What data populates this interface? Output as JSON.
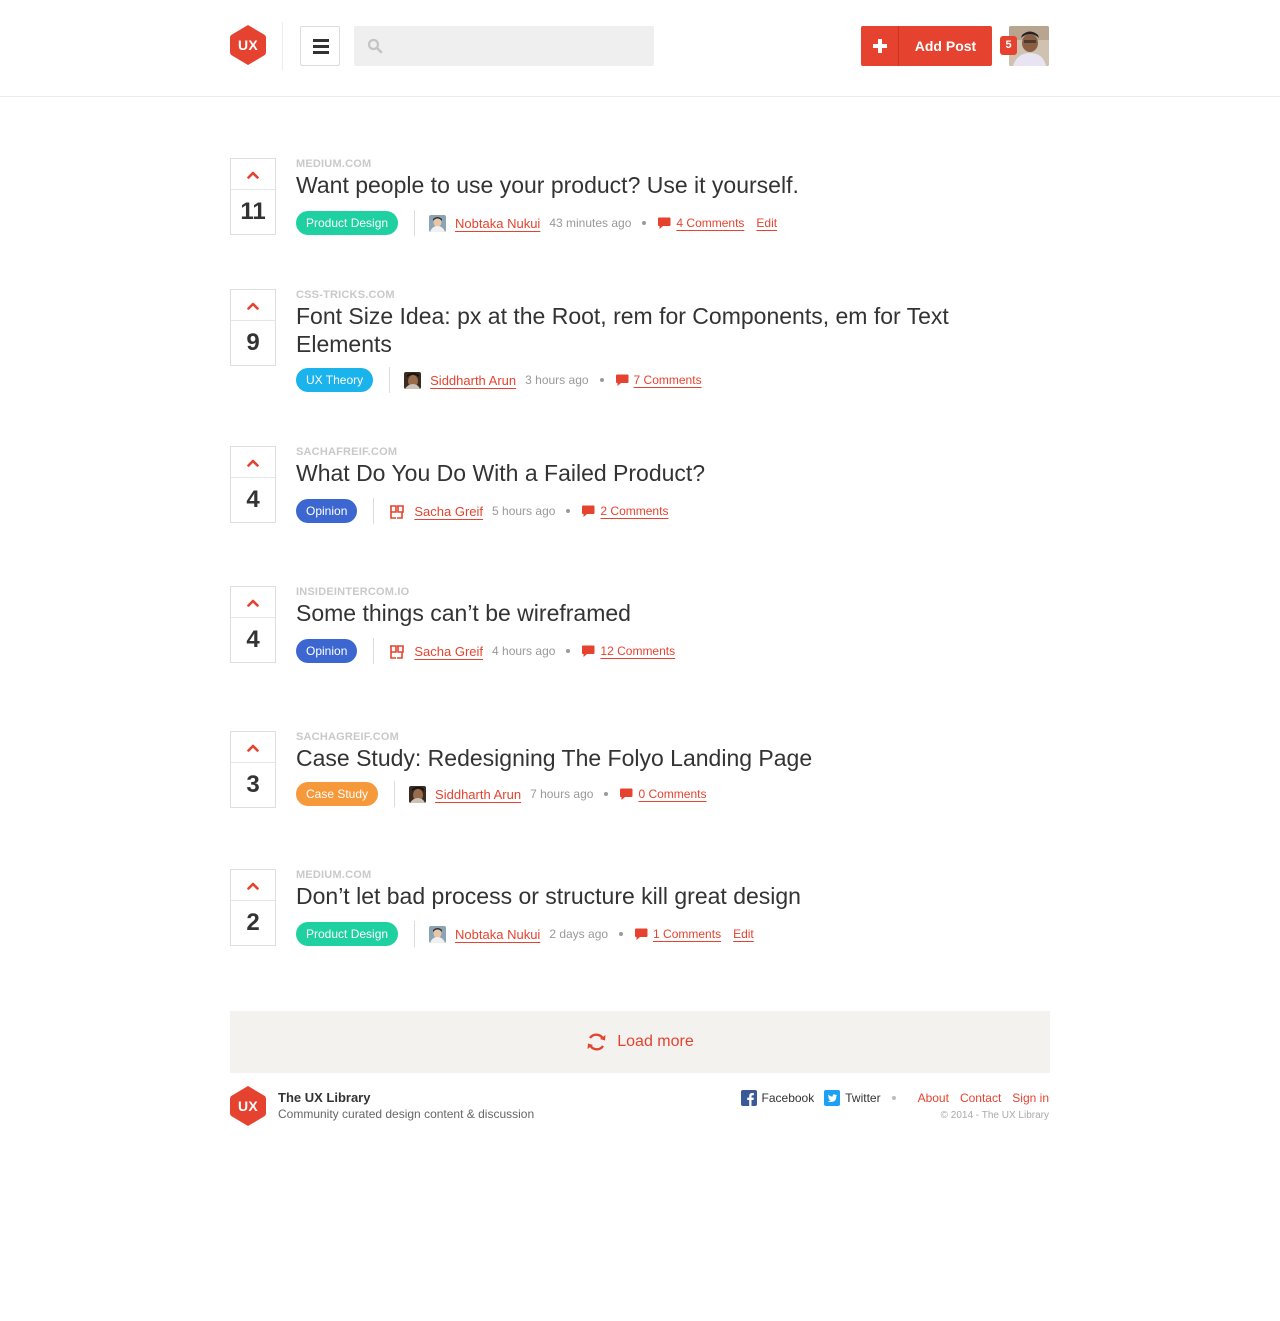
{
  "header": {
    "logo_text": "UX",
    "search": {
      "placeholder": "",
      "value": ""
    },
    "add_post_label": "Add Post",
    "notification_count": "5"
  },
  "posts": [
    {
      "votes": "11",
      "domain": "MEDIUM.COM",
      "title": "Want people to use your product? Use it yourself.",
      "tag": "Product Design",
      "tag_color": "#1fd1a0",
      "author": "Nobtaka Nukui",
      "time": "43 minutes ago",
      "comments": "4 Comments",
      "edit": "Edit"
    },
    {
      "votes": "9",
      "domain": "CSS-TRICKS.COM",
      "title": "Font Size Idea: px at the Root, rem for Components, em for Text Elements",
      "tag": "UX Theory",
      "tag_color": "#1ab3ec",
      "author": "Siddharth Arun",
      "time": "3 hours ago",
      "comments": "7 Comments",
      "edit": ""
    },
    {
      "votes": "4",
      "domain": "SACHAFREIF.COM",
      "title": "What Do You Do With a Failed Product?",
      "tag": "Opinion",
      "tag_color": "#3c67d1",
      "author": "Sacha Greif",
      "time": "5 hours ago",
      "comments": "2 Comments",
      "edit": ""
    },
    {
      "votes": "4",
      "domain": "INSIDEINTERCOM.IO",
      "title": "Some things can’t be wireframed",
      "tag": "Opinion",
      "tag_color": "#3c67d1",
      "author": "Sacha Greif",
      "time": "4 hours ago",
      "comments": "12 Comments",
      "edit": ""
    },
    {
      "votes": "3",
      "domain": "SACHAGREIF.COM",
      "title": "Case Study: Redesigning The Folyo Landing Page",
      "tag": "Case Study",
      "tag_color": "#f5993b",
      "author": "Siddharth Arun",
      "time": "7 hours ago",
      "comments": "0 Comments",
      "edit": ""
    },
    {
      "votes": "2",
      "domain": "MEDIUM.COM",
      "title": "Don’t let bad process or structure kill great design",
      "tag": "Product Design",
      "tag_color": "#1fd1a0",
      "author": "Nobtaka Nukui",
      "time": "2 days ago",
      "comments": "1 Comments",
      "edit": "Edit"
    }
  ],
  "load_more_label": "Load more",
  "footer": {
    "logo_text": "UX",
    "site_name": "The UX Library",
    "tagline": "Community curated design content & discussion",
    "facebook": "Facebook",
    "twitter": "Twitter",
    "about": "About",
    "contact": "Contact",
    "sign_in": "Sign in",
    "copyright": "© 2014 - The UX Library"
  },
  "colors": {
    "accent": "#e5432f",
    "facebook": "#3b5998",
    "twitter": "#1da1f2"
  }
}
